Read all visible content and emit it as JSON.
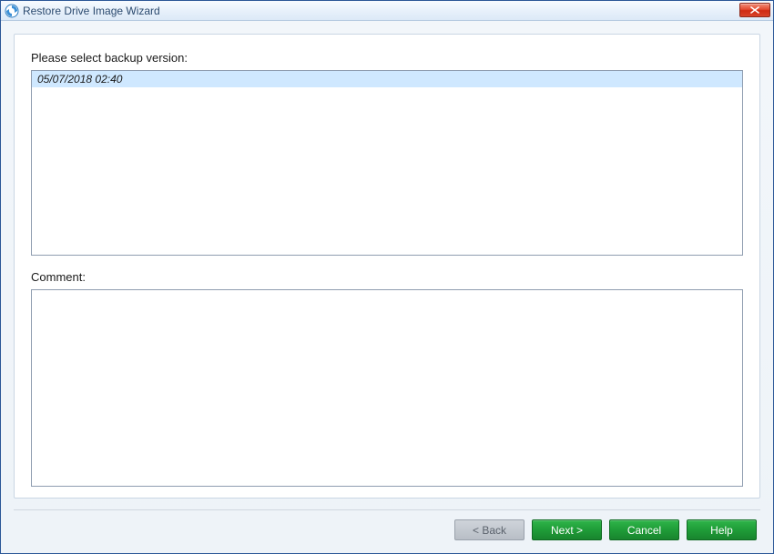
{
  "window": {
    "title": "Restore Drive Image Wizard"
  },
  "labels": {
    "select_backup_version": "Please select backup version:",
    "comment": "Comment:"
  },
  "versions": {
    "items": [
      {
        "label": "05/07/2018 02:40",
        "selected": true
      }
    ]
  },
  "comment": {
    "value": ""
  },
  "buttons": {
    "back": "< Back",
    "next": "Next >",
    "cancel": "Cancel",
    "help": "Help"
  }
}
